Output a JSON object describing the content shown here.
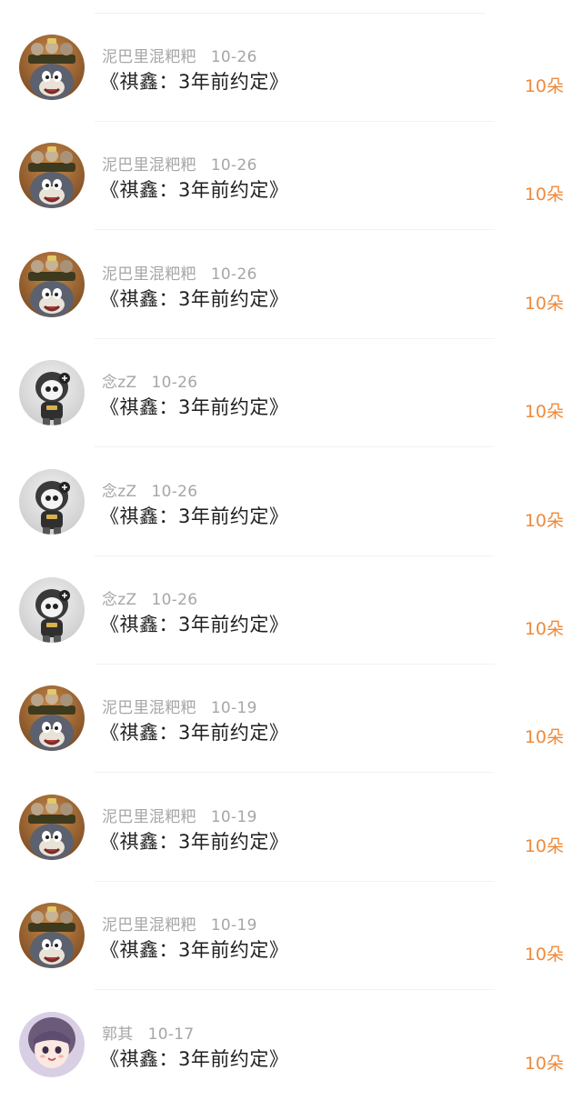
{
  "gift_list": {
    "items": [
      {
        "user": "泥巴里混粑粑",
        "date": "10-26",
        "title": "《祺鑫：3年前约定》",
        "amount": "10朵",
        "avatar": "cartoon-cat-mouse-avatar"
      },
      {
        "user": "泥巴里混粑粑",
        "date": "10-26",
        "title": "《祺鑫：3年前约定》",
        "amount": "10朵",
        "avatar": "cartoon-cat-mouse-avatar"
      },
      {
        "user": "泥巴里混粑粑",
        "date": "10-26",
        "title": "《祺鑫：3年前约定》",
        "amount": "10朵",
        "avatar": "cartoon-cat-mouse-avatar"
      },
      {
        "user": "念zZ",
        "date": "10-26",
        "title": "《祺鑫：3年前约定》",
        "amount": "10朵",
        "avatar": "toy-figure-avatar"
      },
      {
        "user": "念zZ",
        "date": "10-26",
        "title": "《祺鑫：3年前约定》",
        "amount": "10朵",
        "avatar": "toy-figure-avatar"
      },
      {
        "user": "念zZ",
        "date": "10-26",
        "title": "《祺鑫：3年前约定》",
        "amount": "10朵",
        "avatar": "toy-figure-avatar"
      },
      {
        "user": "泥巴里混粑粑",
        "date": "10-19",
        "title": "《祺鑫：3年前约定》",
        "amount": "10朵",
        "avatar": "cartoon-cat-mouse-avatar"
      },
      {
        "user": "泥巴里混粑粑",
        "date": "10-19",
        "title": "《祺鑫：3年前约定》",
        "amount": "10朵",
        "avatar": "cartoon-cat-mouse-avatar"
      },
      {
        "user": "泥巴里混粑粑",
        "date": "10-19",
        "title": "《祺鑫：3年前约定》",
        "amount": "10朵",
        "avatar": "cartoon-cat-mouse-avatar"
      },
      {
        "user": "郭其",
        "date": "10-17",
        "title": "《祺鑫：3年前约定》",
        "amount": "10朵",
        "avatar": "anime-girl-avatar"
      }
    ]
  },
  "colors": {
    "username": "#a6a6a6",
    "title": "#1f1f1f",
    "amount": "#ee8a3c",
    "divider": "#f2f2f2"
  }
}
